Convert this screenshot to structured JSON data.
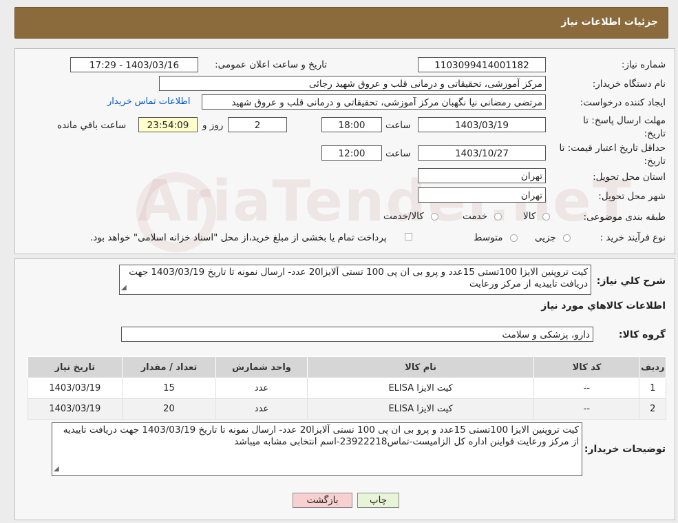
{
  "header": {
    "title": "جزئیات اطلاعات نیاز"
  },
  "form": {
    "need_number_label": "شماره نیاز:",
    "need_number": "1103099414001182",
    "announce_label": "تاریخ و ساعت اعلان عمومی:",
    "announce_value": "1403/03/16 - 17:29",
    "buyer_org_label": "نام دستگاه خریدار:",
    "buyer_org": "مرکز آموزشی، تحقیقاتی و درمانی قلب و عروق شهید رجائی",
    "creator_label": "ایجاد کننده درخواست:",
    "creator": "مرتضی رمضانی نیا نگهبان مرکز آموزشی، تحقیقاتی و درمانی قلب و عروق شهید",
    "contact_link": "اطلاعات تماس خریدار",
    "deadline_label": "مهلت ارسال پاسخ: تا تاریخ:",
    "deadline_date": "1403/03/19",
    "time_label": "ساعت",
    "deadline_time": "18:00",
    "days_value": "2",
    "days_label": "روز و",
    "remaining_time": "23:54:09",
    "remaining_label": "ساعت باقي مانده",
    "price_valid_label": "حداقل تاریخ اعتبار قیمت: تا تاریخ:",
    "price_valid_date": "1403/10/27",
    "price_valid_time": "12:00",
    "province_label": "استان محل تحویل:",
    "province": "تهران",
    "city_label": "شهر محل تحویل:",
    "city": "تهران",
    "category_label": "طبقه بندی موضوعی:",
    "category_options": [
      "کالا",
      "خدمت",
      "کالا/خدمت"
    ],
    "process_label": "نوع فرآیند خرید :",
    "process_options": [
      "جزیی",
      "متوسط"
    ],
    "process_note": "پرداخت تمام یا بخشی از مبلغ خرید،از محل \"اسناد خزانه اسلامی\" خواهد بود."
  },
  "details": {
    "summary_label": "شرح کلي نياز:",
    "summary_text": "کیت تروپنین الایزا 100تستی 15عدد و پرو بی ان پی 100 تستی آلایزا20 عدد- ارسال نمونه تا تاریخ 1403/03/19 جهت دریافت تاییدیه از مرکز ورعایت",
    "goods_info_title": "اطلاعات کالاهاي مورد نياز",
    "goods_group_label": "گروه کالا:",
    "goods_group": "دارو، پزشکی و سلامت",
    "table": {
      "headers": [
        "ردیف",
        "کد کالا",
        "نام کالا",
        "واحد شمارش",
        "تعداد / مقدار",
        "تاریخ نیاز"
      ],
      "rows": [
        [
          "1",
          "--",
          "کیت الایزا ELISA",
          "عدد",
          "15",
          "1403/03/19"
        ],
        [
          "2",
          "--",
          "کیت الایزا ELISA",
          "عدد",
          "20",
          "1403/03/19"
        ]
      ]
    },
    "buyer_notes_label": "توضیحات خریدار:",
    "buyer_notes": "کیت تروپنین الایزا 100تستی 15عدد و پرو بی ان پی 100 تستی آلایزا20 عدد- ارسال نمونه تا تاریخ 1403/03/19 جهت دریافت تاییدیه از مرکز ورعایت قواینن اداره کل الزامیست-تماس23922218-اسم انتخابی مشابه میباشد"
  },
  "buttons": {
    "print": "چاپ",
    "back": "بازگشت"
  },
  "colors": {
    "header": "#8b6a3c",
    "back_button": "#f8d0d0",
    "print_button": "#e8f4d8"
  }
}
